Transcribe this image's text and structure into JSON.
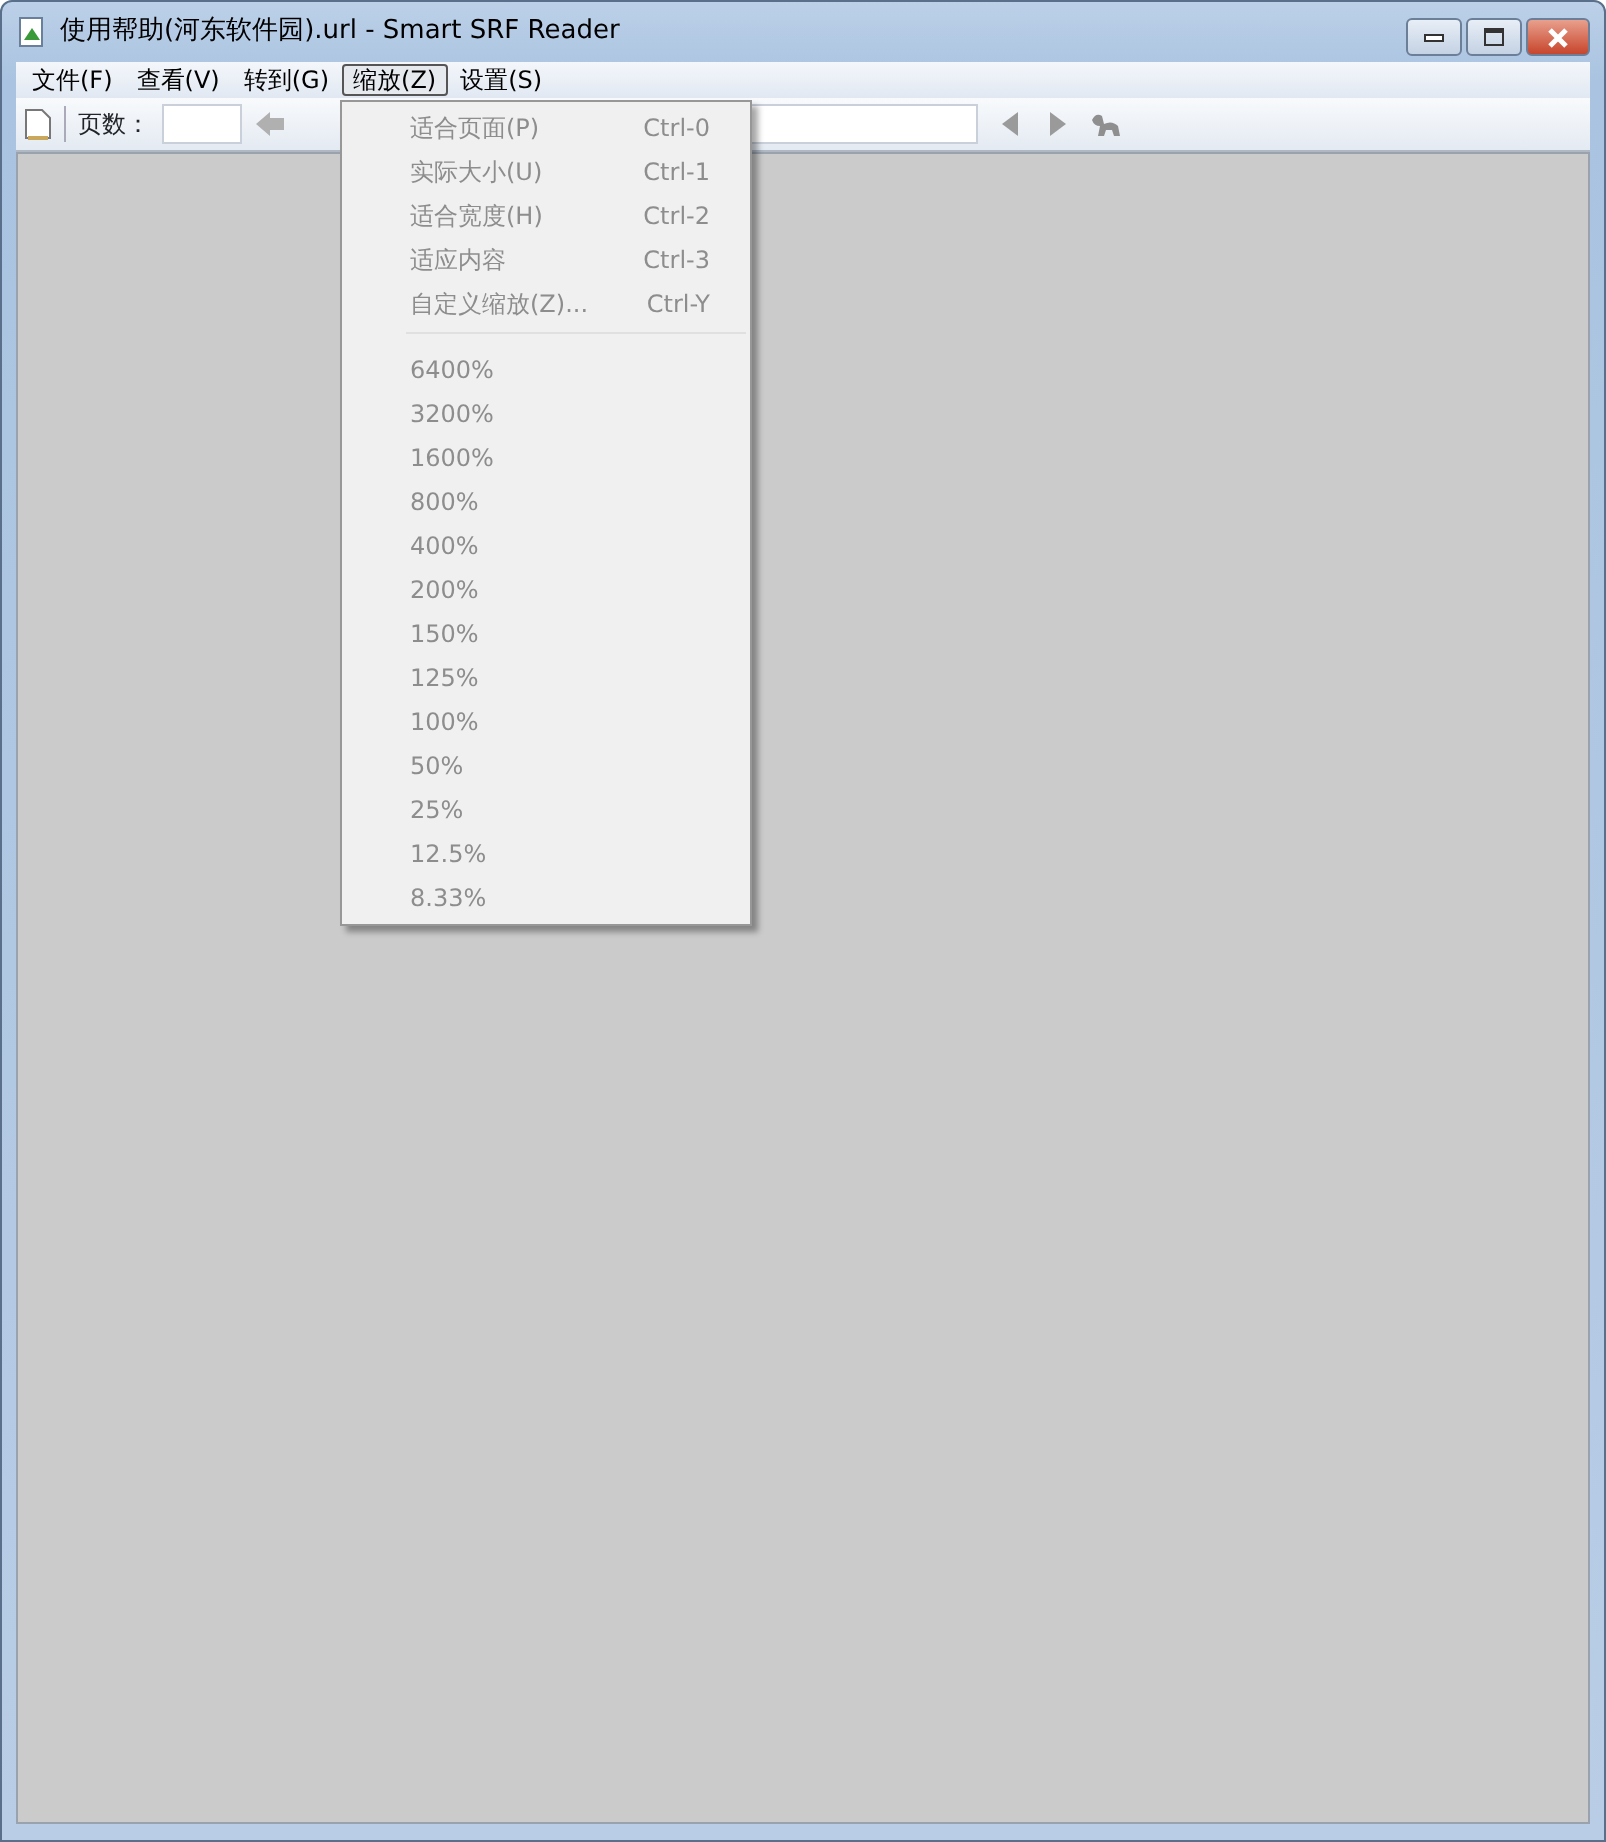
{
  "window": {
    "title": "使用帮助(河东软件园).url - Smart SRF Reader"
  },
  "menu_bar": [
    {
      "label": "文件(F)",
      "selected": false
    },
    {
      "label": "查看(V)",
      "selected": false
    },
    {
      "label": "转到(G)",
      "selected": false
    },
    {
      "label": "缩放(Z)",
      "selected": true
    },
    {
      "label": "设置(S)",
      "selected": false
    }
  ],
  "toolbar": {
    "page_label": "页数："
  },
  "zoom_menu": [
    {
      "kind": "item",
      "label": "适合页面(P)",
      "shortcut": "Ctrl-0",
      "disabled": true
    },
    {
      "kind": "item",
      "label": "实际大小(U)",
      "shortcut": "Ctrl-1",
      "disabled": true
    },
    {
      "kind": "item",
      "label": "适合宽度(H)",
      "shortcut": "Ctrl-2",
      "disabled": true
    },
    {
      "kind": "item",
      "label": "适应内容",
      "shortcut": "Ctrl-3",
      "disabled": true
    },
    {
      "kind": "item",
      "label": "自定义缩放(Z)...",
      "shortcut": "Ctrl-Y",
      "disabled": true
    },
    {
      "kind": "separator"
    },
    {
      "kind": "item",
      "label": "6400%",
      "disabled": true
    },
    {
      "kind": "item",
      "label": "3200%",
      "disabled": true
    },
    {
      "kind": "item",
      "label": "1600%",
      "disabled": true
    },
    {
      "kind": "item",
      "label": "800%",
      "disabled": true
    },
    {
      "kind": "item",
      "label": "400%",
      "disabled": true
    },
    {
      "kind": "item",
      "label": "200%",
      "disabled": true
    },
    {
      "kind": "item",
      "label": "150%",
      "disabled": true
    },
    {
      "kind": "item",
      "label": "125%",
      "disabled": true
    },
    {
      "kind": "item",
      "label": "100%",
      "disabled": true
    },
    {
      "kind": "item",
      "label": "50%",
      "disabled": true
    },
    {
      "kind": "item",
      "label": "25%",
      "disabled": true
    },
    {
      "kind": "item",
      "label": "12.5%",
      "disabled": true
    },
    {
      "kind": "item",
      "label": "8.33%",
      "disabled": true
    }
  ]
}
